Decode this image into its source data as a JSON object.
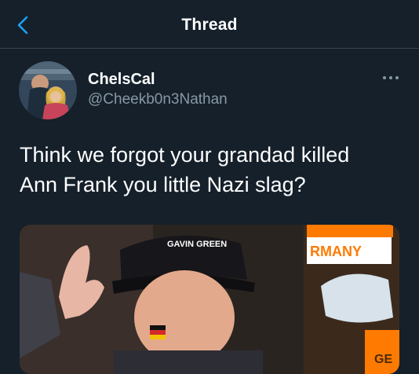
{
  "header": {
    "title": "Thread",
    "back_icon": "chevron-left-icon"
  },
  "colors": {
    "background": "#15202b",
    "accent": "#1da1f2",
    "secondary_text": "#8899a6",
    "divider": "#38444d"
  },
  "tweet": {
    "display_name": "ChelsCal",
    "handle": "@Cheekb0n3Nathan",
    "more_icon": "more-options-icon",
    "text_lines": [
      "Think we forgot your grandad killed",
      "Ann Frank you little Nazi slag?"
    ],
    "media": {
      "cap_text": "GAVIN GREEN",
      "banner_text": "RMANY",
      "sign_text": "GE"
    }
  }
}
